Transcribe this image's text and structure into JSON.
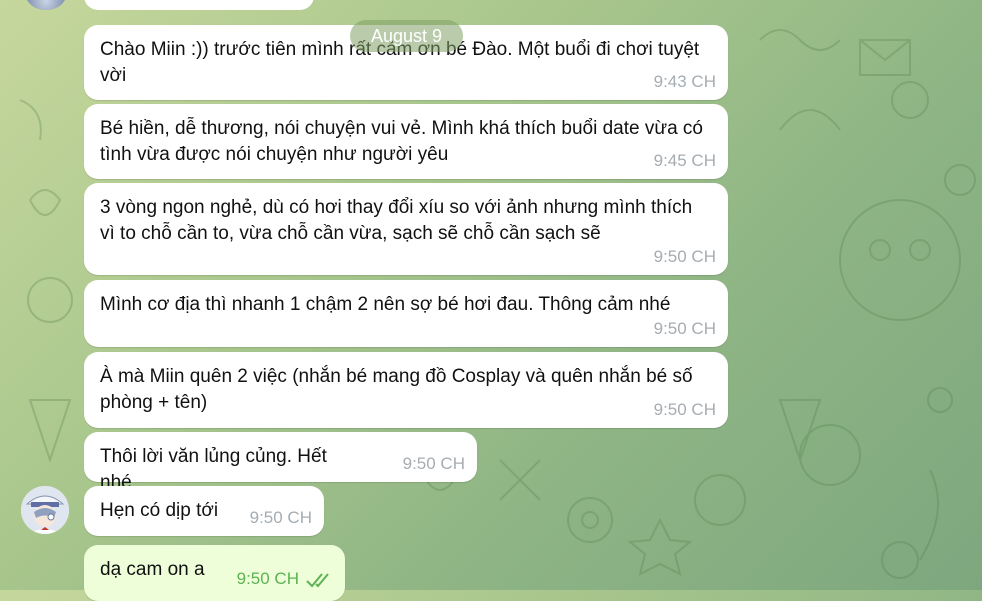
{
  "chat": {
    "date_label": "August 9",
    "messages": [
      {
        "text": "Chào Miin :)) trước tiên mình rất cảm ơn bé Đào. Một buổi đi chơi tuyệt vời",
        "time": "9:43 CH"
      },
      {
        "text": "Bé hiền, dễ thương, nói chuyện vui vẻ. Mình khá thích buổi date vừa có tình vừa được nói chuyện như người yêu",
        "time": "9:45 CH"
      },
      {
        "text": "3 vòng ngon nghẻ, dù có hơi thay đổi xíu so với ảnh nhưng mình thích vì to chỗ cần to, vừa chỗ cần vừa, sạch sẽ chỗ cần sạch sẽ",
        "time": "9:50 CH"
      },
      {
        "text": "Mình cơ địa thì nhanh 1 chậm 2 nên sợ bé hơi đau. Thông cảm nhé",
        "time": "9:50 CH"
      },
      {
        "text": "À mà Miin quên 2 việc (nhắn bé mang đồ Cosplay và quên nhắn bé số phòng + tên)",
        "time": "9:50 CH"
      },
      {
        "text": "Thôi lời văn lủng củng. Hết nhé",
        "time": "9:50 CH"
      },
      {
        "text": "Hẹn có dịp tới",
        "time": "9:50 CH"
      }
    ],
    "outgoing": {
      "text": "dạ cam on a",
      "time": "9:50 CH",
      "status_icon": "double-check-icon"
    }
  },
  "colors": {
    "bubble_in": "#ffffff",
    "bubble_out": "#eefed9",
    "time_in": "#a5adb3",
    "time_out": "#5db352",
    "wallpaper": "#a9c78d"
  }
}
